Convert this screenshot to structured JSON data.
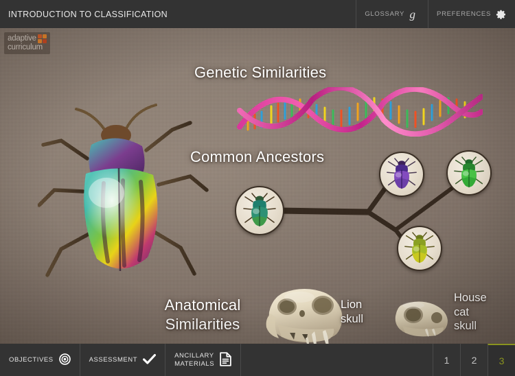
{
  "topbar": {
    "title": "INTRODUCTION TO CLASSIFICATION",
    "glossary_label": "GLOSSARY",
    "glossary_icon": "glossary-g-icon",
    "preferences_label": "PREFERENCES",
    "preferences_icon": "gear-icon"
  },
  "logo": {
    "line1": "adaptive",
    "line2": "curriculum",
    "mark_icon": "squares-mark-icon",
    "mark_color": "#e0612a"
  },
  "stage": {
    "headings": {
      "genetic": "Genetic Similarities",
      "ancestors": "Common Ancestors",
      "anatomical_line1": "Anatomical",
      "anatomical_line2": "Similarities"
    },
    "labels": {
      "lion_line1": "Lion",
      "lion_line2": "skull",
      "cat_line1": "House",
      "cat_line2": "cat",
      "cat_line3": "skull"
    },
    "illustrations": {
      "big_beetle": "rainbow-beetle-illustration",
      "dna_helix": "dna-double-helix-illustration",
      "lion_skull": "lion-skull-photo",
      "cat_skull": "house-cat-skull-photo"
    },
    "tree": {
      "ancestor": {
        "name": "ancestor-beetle-node",
        "color": "#3f7f62"
      },
      "descendants": [
        {
          "name": "purple-beetle-node",
          "color": "#6b3fa0"
        },
        {
          "name": "green-beetle-node",
          "color": "#2fa02f"
        },
        {
          "name": "yellow-beetle-node",
          "color": "#b5b521"
        }
      ]
    },
    "background_color": "#8a7b70"
  },
  "bottombar": {
    "buttons": [
      {
        "label": "OBJECTIVES",
        "icon": "target-icon"
      },
      {
        "label": "ASSESSMENT",
        "icon": "check-icon"
      },
      {
        "label_line1": "ANCILLARY",
        "label_line2": "MATERIALS",
        "icon": "document-icon"
      }
    ],
    "pages": [
      {
        "label": "1",
        "active": false
      },
      {
        "label": "2",
        "active": false
      },
      {
        "label": "3",
        "active": true
      }
    ],
    "active_color": "#8a941f"
  }
}
